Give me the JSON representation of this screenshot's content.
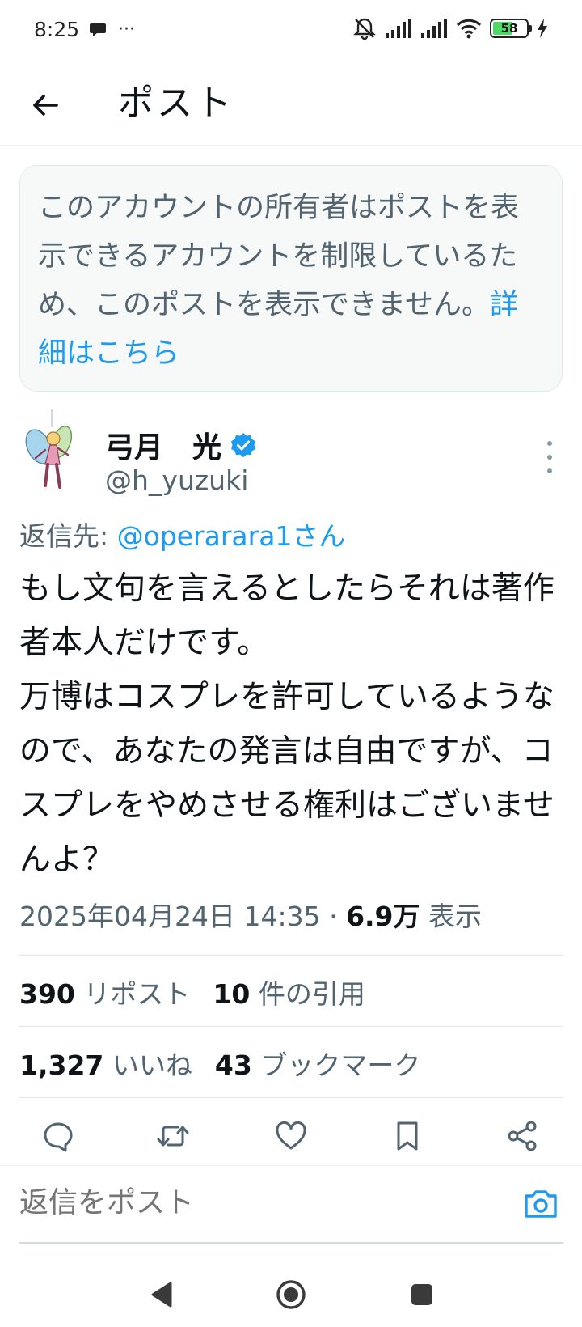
{
  "status_bar": {
    "time": "8:25",
    "ellipsis": "···",
    "battery_level": "58",
    "battery_fraction": 0.58
  },
  "header": {
    "title": "ポスト",
    "back_icon": "arrow-left-icon"
  },
  "notice": {
    "text": "このアカウントの所有者はポストを表示できるアカウントを制限しているため、このポストを表示できません。",
    "link": "詳細はこちら"
  },
  "post": {
    "author_name": "弓月　光",
    "author_handle": "@h_yuzuki",
    "reply_prefix": "返信先: ",
    "reply_mention": "@operarara1さん",
    "body": "もし文句を言えるとしたらそれは著作者本人だけです。\n万博はコスプレを許可しているようなので、あなたの発言は自由ですが、コスプレをやめさせる権利はございませんよ？",
    "timestamp": "2025年04月24日 14:35",
    "separator": "·",
    "views_count": "6.9万",
    "views_label": "表示"
  },
  "stats": {
    "reposts_count": "390",
    "reposts_label": "リポスト",
    "quotes_count": "10",
    "quotes_label": "件の引用",
    "likes_count": "1,327",
    "likes_label": "いいね",
    "bookmarks_count": "43",
    "bookmarks_label": "ブックマーク"
  },
  "actions": [
    "reply-icon",
    "repost-icon",
    "like-icon",
    "bookmark-icon",
    "share-icon"
  ],
  "reply_bar": {
    "placeholder": "返信をポスト"
  },
  "colors": {
    "accent": "#1d9bf0",
    "text_primary": "#0f1419",
    "text_secondary": "#536471",
    "divider": "#e1e8ed",
    "notice_bg": "#f7f9f9"
  }
}
